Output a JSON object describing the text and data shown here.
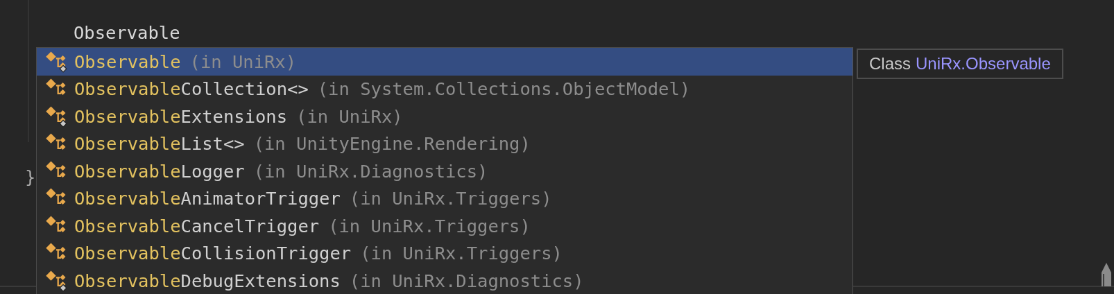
{
  "editor": {
    "typed_text": "Observable",
    "closing_brace": "}"
  },
  "completion": {
    "items": [
      {
        "match": "Observable",
        "location": "(in UniRx)",
        "selected": true,
        "overlay": true
      },
      {
        "match": "Observable",
        "rest": "Collection<>",
        "location": "(in System.Collections.ObjectModel)",
        "selected": false,
        "overlay": false
      },
      {
        "match": "Observable",
        "rest": "Extensions",
        "location": "(in UniRx)",
        "selected": false,
        "overlay": true
      },
      {
        "match": "Observable",
        "rest": "List<>",
        "location": "(in UnityEngine.Rendering)",
        "selected": false,
        "overlay": false
      },
      {
        "match": "Observable",
        "rest": "Logger",
        "location": "(in UniRx.Diagnostics)",
        "selected": false,
        "overlay": false
      },
      {
        "match": "Observable",
        "rest": "AnimatorTrigger",
        "location": "(in UniRx.Triggers)",
        "selected": false,
        "overlay": false
      },
      {
        "match": "Observable",
        "rest": "CancelTrigger",
        "location": "(in UniRx.Triggers)",
        "selected": false,
        "overlay": false
      },
      {
        "match": "Observable",
        "rest": "CollisionTrigger",
        "location": "(in UniRx.Triggers)",
        "selected": false,
        "overlay": false
      },
      {
        "match": "Observable",
        "rest": "DebugExtensions",
        "location": "(in UniRx.Diagnostics)",
        "selected": false,
        "overlay": true
      }
    ]
  },
  "tooltip": {
    "kind_label": "Class",
    "name": "UniRx.Observable"
  }
}
